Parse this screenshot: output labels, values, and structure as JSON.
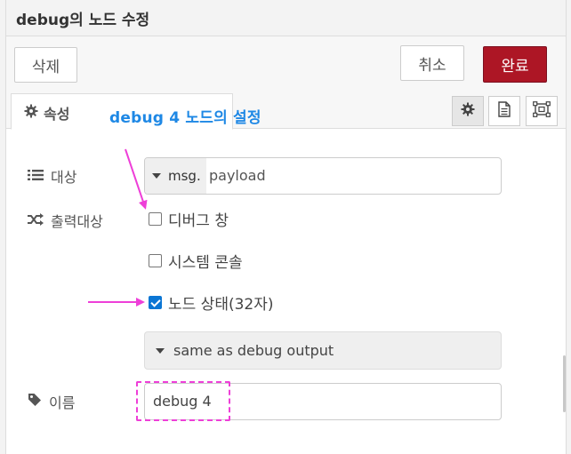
{
  "header": {
    "title": "debug의 노드 수정"
  },
  "toolbar": {
    "delete_label": "삭제",
    "cancel_label": "취소",
    "done_label": "완료"
  },
  "tabs": {
    "properties_label": "속성"
  },
  "annotation": {
    "title": "debug 4 노드의 설정"
  },
  "form": {
    "target_label": "대상",
    "target_prefix": "msg.",
    "target_value": "payload",
    "output_label": "출력대상",
    "output_options": [
      {
        "label": "디버그 창",
        "checked": false
      },
      {
        "label": "시스템 콘솔",
        "checked": false
      },
      {
        "label": "노드 상태(32자)",
        "checked": true
      }
    ],
    "status_select": "same as debug output",
    "name_label": "이름",
    "name_value": "debug 4"
  },
  "colors": {
    "done_button": "#ad1625",
    "annotation_text": "#1e88e5",
    "arrow_magenta": "#ee3fd8",
    "checkbox_checked": "#0b76d4"
  },
  "icons": {
    "properties_tab": "gear-icon",
    "target": "list-icon",
    "output": "shuffle-icon",
    "name": "tag-icon",
    "tab_buttons": [
      "gear-icon",
      "document-icon",
      "layout-icon"
    ]
  }
}
